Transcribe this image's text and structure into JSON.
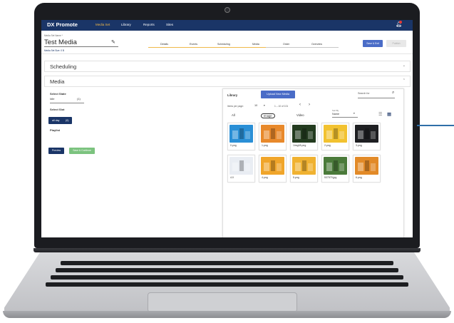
{
  "app": {
    "brand": "DX Promote",
    "nav": [
      "Media Set",
      "Library",
      "Reports",
      "Sites"
    ],
    "active_nav": "Media Set"
  },
  "header": {
    "name_label": "Media Set Name *",
    "title": "Test Media",
    "size_label": "Media Set Size: 0 B",
    "steps": [
      "Details",
      "Events",
      "Scheduling",
      "Media",
      "Order",
      "Overview"
    ],
    "active_step": "Media",
    "save_exit": "Save & Exit",
    "publish": "Publish"
  },
  "sections": {
    "scheduling": "Scheduling",
    "media": "Media"
  },
  "left": {
    "select_state": "Select State",
    "state_name": "Idle",
    "state_count": "(1)",
    "select_slot": "Select Slot",
    "slot_name": "all day",
    "slot_count": "(0)",
    "playlist": "Playlist",
    "preview": "Preview",
    "save_continue": "Save & Continue"
  },
  "library": {
    "title": "Library",
    "upload": "Upload New Media",
    "search_placeholder": "Search for",
    "items_per_page_label": "Items per page:",
    "items_per_page": "10",
    "range": "1 – 10 of 101",
    "sort_label": "Sort By",
    "sort_value": "Name",
    "filters": [
      "All",
      "Image",
      "Video"
    ],
    "active_filter": "Image",
    "items": [
      {
        "name": "0.png",
        "color": "#2a8fd6"
      },
      {
        "name": "1.png",
        "color": "#e8892b"
      },
      {
        "name": "1img18.png",
        "color": "#233b1f"
      },
      {
        "name": "2.png",
        "color": "#f2c230"
      },
      {
        "name": "3.png",
        "color": "#1e1f22"
      },
      {
        "name": "4.0",
        "color": "#e9edf3"
      },
      {
        "name": "4.png",
        "color": "#f0a52a"
      },
      {
        "name": "5.png",
        "color": "#f0b231"
      },
      {
        "name": "537579.jpg",
        "color": "#4a7a3a"
      },
      {
        "name": "6.png",
        "color": "#e28a28"
      }
    ]
  }
}
